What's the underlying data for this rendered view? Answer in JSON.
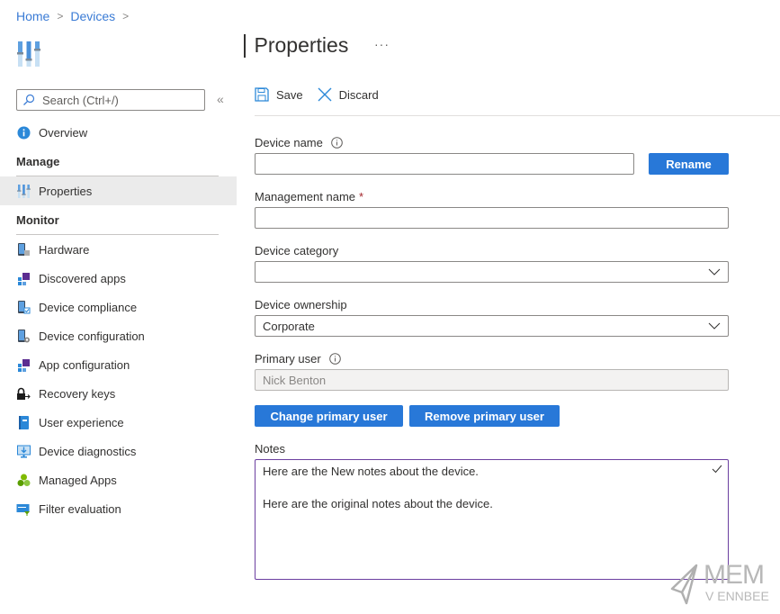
{
  "breadcrumb": [
    {
      "label": "Home"
    },
    {
      "label": "Devices"
    }
  ],
  "page": {
    "title": "Properties",
    "more_label": "···"
  },
  "search": {
    "placeholder": "Search (Ctrl+/)",
    "value": "",
    "collapse_label": "«"
  },
  "nav": {
    "top_items": [
      {
        "label": "Overview",
        "icon": "info-icon"
      }
    ],
    "sections": [
      {
        "title": "Manage",
        "items": [
          {
            "label": "Properties",
            "icon": "properties-icon",
            "active": true
          }
        ]
      },
      {
        "title": "Monitor",
        "items": [
          {
            "label": "Hardware",
            "icon": "hardware-icon"
          },
          {
            "label": "Discovered apps",
            "icon": "discovered-apps-icon"
          },
          {
            "label": "Device compliance",
            "icon": "device-compliance-icon"
          },
          {
            "label": "Device configuration",
            "icon": "device-configuration-icon"
          },
          {
            "label": "App configuration",
            "icon": "app-configuration-icon"
          },
          {
            "label": "Recovery keys",
            "icon": "recovery-keys-icon"
          },
          {
            "label": "User experience",
            "icon": "user-experience-icon"
          },
          {
            "label": "Device diagnostics",
            "icon": "device-diagnostics-icon"
          },
          {
            "label": "Managed Apps",
            "icon": "managed-apps-icon"
          },
          {
            "label": "Filter evaluation",
            "icon": "filter-evaluation-icon"
          }
        ]
      }
    ]
  },
  "toolbar": {
    "save_label": "Save",
    "discard_label": "Discard"
  },
  "form": {
    "device_name": {
      "label": "Device name",
      "value": ""
    },
    "rename_label": "Rename",
    "management_name": {
      "label": "Management name",
      "required_mark": "*",
      "value": ""
    },
    "device_category": {
      "label": "Device category",
      "value": ""
    },
    "device_ownership": {
      "label": "Device ownership",
      "value": "Corporate"
    },
    "primary_user": {
      "label": "Primary user",
      "value": "Nick Benton"
    },
    "change_primary_user_label": "Change primary user",
    "remove_primary_user_label": "Remove primary user",
    "notes": {
      "label": "Notes",
      "lines": [
        "Here are the New notes about the device.",
        "Here are the original notes about the device."
      ]
    }
  },
  "watermark": {
    "line1": "MEM",
    "line2": "V ENNBEE"
  },
  "colors": {
    "accent": "#2878d8",
    "link": "#3a7bd5",
    "notes_border": "#6b3fa0",
    "required": "#a4262c"
  }
}
